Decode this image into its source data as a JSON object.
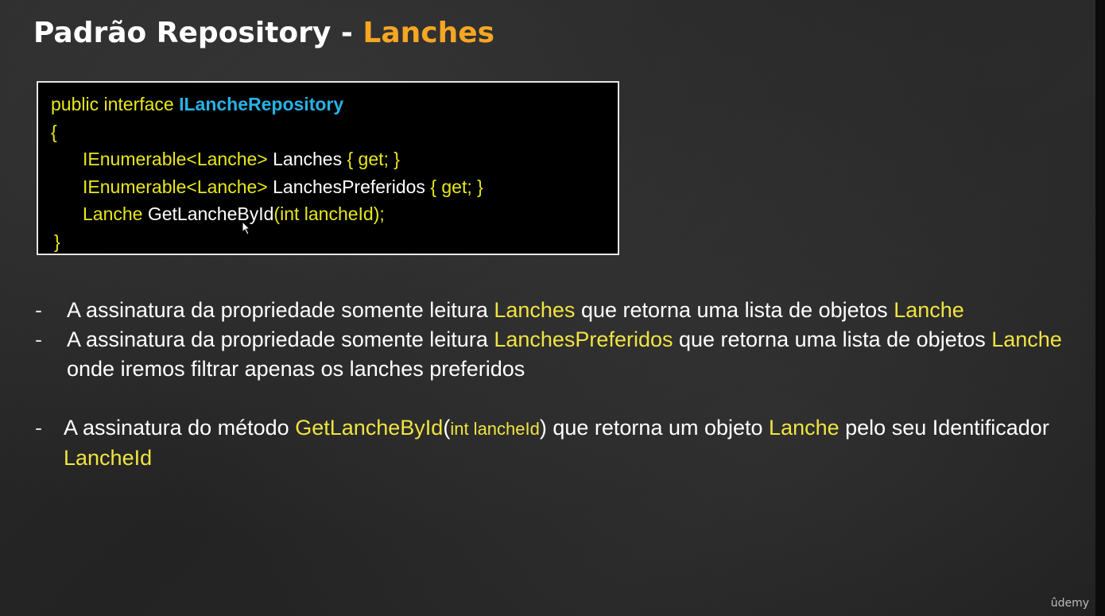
{
  "title": {
    "main": "Padrão Repository - ",
    "accent": "Lanches"
  },
  "code": {
    "line1_kw": "public interface ",
    "line1_type": "ILancheRepository",
    "line2": "{",
    "line3_kw": "IEnumerable<Lanche> ",
    "line3_name": "Lanches ",
    "line3_tail": "{ get; }",
    "line4_kw": "IEnumerable<Lanche> ",
    "line4_name": "LanchesPreferidos ",
    "line4_tail": "{ get; }",
    "line5_kw": "Lanche ",
    "line5_name": "GetLancheById",
    "line5_tail": "(int lancheId);",
    "line6": "}"
  },
  "bullets": [
    {
      "dash": "-",
      "t1": "A assinatura da propriedade somente leitura ",
      "h1": "Lanches",
      "t2": " que retorna uma lista de objetos ",
      "h2": "Lanche"
    },
    {
      "dash": "-",
      "t1": "A assinatura da propriedade somente leitura ",
      "h1": "LanchesPreferidos",
      "t2": " que retorna uma lista de  objetos ",
      "h2": "Lanche",
      "t3": " onde iremos filtrar apenas os lanches preferidos"
    },
    {
      "dash": "-",
      "t1": "A assinatura do método ",
      "h1": "GetLancheById",
      "p1": "(",
      "small": "int lancheId",
      "p2": ")",
      "t2": " que retorna um objeto ",
      "h2": "Lanche",
      "t3": " pelo seu Identificador ",
      "h3": "LancheId"
    }
  ],
  "watermark": "ûdemy",
  "colors": {
    "title_accent": "#f5a623",
    "code_keyword": "#e8e81a",
    "code_type": "#27b2e6",
    "highlight": "#f0e442"
  }
}
